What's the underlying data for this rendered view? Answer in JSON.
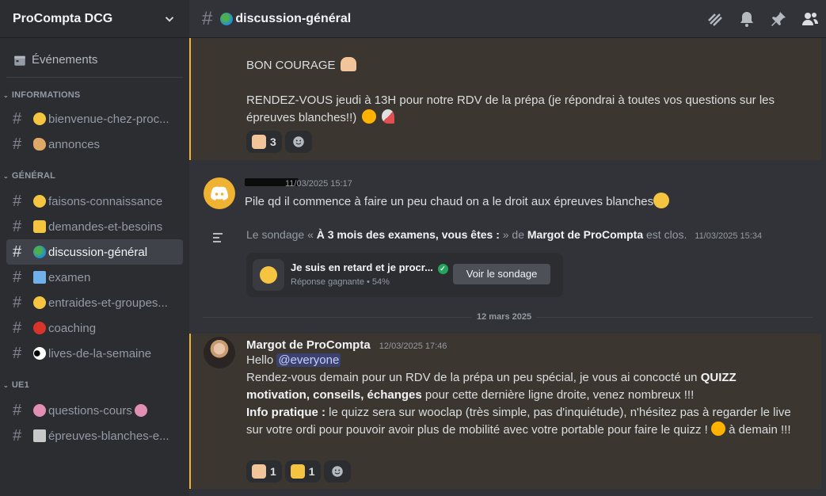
{
  "server": {
    "name": "ProCompta DCG"
  },
  "sidebar": {
    "events_label": "Événements",
    "categories": [
      {
        "name": "INFORMATIONS",
        "channels": [
          {
            "name": "bienvenue-chez-proc...",
            "emoji_color": "#f5c542",
            "active": false
          },
          {
            "name": "annonces",
            "emoji_color": "#e0a867",
            "active": false
          }
        ]
      },
      {
        "name": "GÉNÉRAL",
        "channels": [
          {
            "name": "faisons-connaissance",
            "emoji_color": "#f5c542",
            "active": false
          },
          {
            "name": "demandes-et-besoins",
            "emoji_color": "#f5c542",
            "active": false
          },
          {
            "name": "discussion-général",
            "emoji_color": "#2e9b57",
            "active": true
          },
          {
            "name": "examen",
            "emoji_color": "#6fb1e8",
            "active": false
          },
          {
            "name": "entraides-et-groupes...",
            "emoji_color": "#f5c542",
            "active": false
          },
          {
            "name": "coaching",
            "emoji_color": "#d9342b",
            "active": false
          },
          {
            "name": "lives-de-la-semaine",
            "emoji_color": "#ffffff",
            "active": false
          }
        ]
      },
      {
        "name": "UE1",
        "channels": [
          {
            "name": "questions-cours",
            "emoji_color": "#e28fb4",
            "active": false
          },
          {
            "name": "épreuves-blanches-e...",
            "emoji_color": "#c8c8c8",
            "active": false
          }
        ]
      }
    ]
  },
  "topbar": {
    "channel": "discussion-général",
    "icons": [
      "threads-icon",
      "bell-icon",
      "pin-icon",
      "members-icon"
    ]
  },
  "messages": {
    "first": {
      "line1": "BON COURAGE",
      "line2": "RENDEZ-VOUS jeudi à 13H pour notre RDV de la prépa (je répondrai à toutes vos questions sur les épreuves blanches!!)",
      "reaction_count": "3"
    },
    "second": {
      "timestamp": "11/03/2025 15:17",
      "text": "Pile qd il commence à faire un peu chaud on a le droit aux épreuves blanches"
    },
    "poll": {
      "prefix": "Le sondage «",
      "question": "À 3 mois des examens, vous êtes :",
      "middle": "» de",
      "author": "Margot de ProCompta",
      "suffix": "est clos.",
      "timestamp": "11/03/2025 15:34",
      "answer": "Je suis en retard et je procr...",
      "result": "Réponse gagnante • 54%",
      "button": "Voir le sondage"
    },
    "divider_date": "12 mars 2025",
    "margot": {
      "author": "Margot de ProCompta",
      "timestamp": "12/03/2025 17:46",
      "hello": "Hello",
      "mention": "@everyone",
      "p1a": "Rendez-vous demain pour un RDV de la prépa un peu spécial, je vous ai concocté un",
      "p1b": "QUIZZ motivation, conseils, échanges",
      "p1c": "pour cette dernière ligne droite, venez nombreux !!!",
      "p2a": "Info pratique :",
      "p2b": "le quizz sera sur wooclap (très simple, pas d'inquiétude), n'hésitez pas à regarder le live sur votre ordi pour pouvoir avoir plus de mobilité avec votre portable pour faire le quizz !",
      "p2c": "à demain !!!",
      "reaction1": "1",
      "reaction2": "1"
    }
  }
}
